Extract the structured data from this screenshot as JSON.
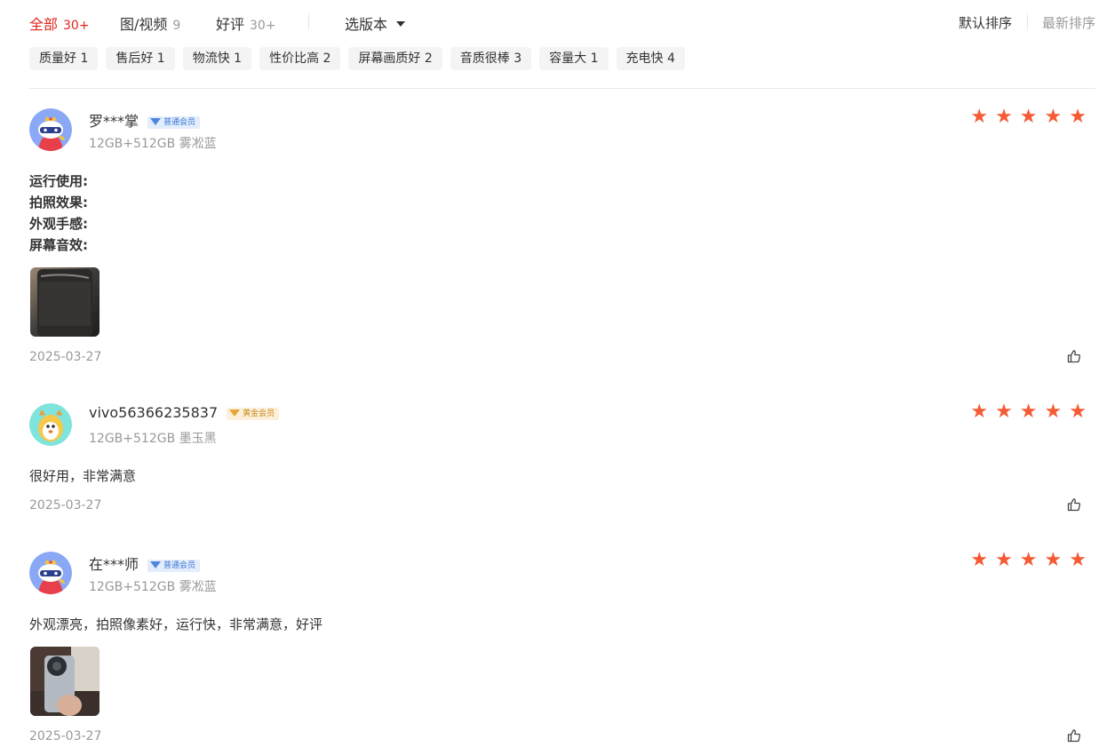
{
  "filters": [
    {
      "label": "全部",
      "count": "30+"
    },
    {
      "label": "图/视频",
      "count": "9"
    },
    {
      "label": "好评",
      "count": "30+"
    }
  ],
  "version_select": {
    "label": "选版本"
  },
  "sort": {
    "default": "默认排序",
    "newest": "最新排序"
  },
  "tags": [
    "质量好 1",
    "售后好 1",
    "物流快 1",
    "性价比高 2",
    "屏幕画质好 2",
    "音质很棒 3",
    "容量大 1",
    "充电快 4"
  ],
  "colors": {
    "accent": "#e1251b",
    "star": "#f55b35",
    "muted": "#999999"
  },
  "reviews": [
    {
      "username": "罗***掌",
      "badge": "普通会员",
      "variant": "12GB+512GB 雾凇蓝",
      "rating": 5,
      "content_lines": [
        "运行使用:",
        "拍照效果:",
        "外观手感:",
        "屏幕音效:"
      ],
      "date": "2025-03-27"
    },
    {
      "username": "vivo56366235837",
      "badge": "黄金会员",
      "variant": "12GB+512GB 墨玉黑",
      "rating": 5,
      "content": "很好用，非常满意",
      "date": "2025-03-27"
    },
    {
      "username": "在***师",
      "badge": "普通会员",
      "variant": "12GB+512GB 雾凇蓝",
      "rating": 5,
      "content": "外观漂亮，拍照像素好，运行快，非常满意，好评",
      "date": "2025-03-27"
    }
  ]
}
